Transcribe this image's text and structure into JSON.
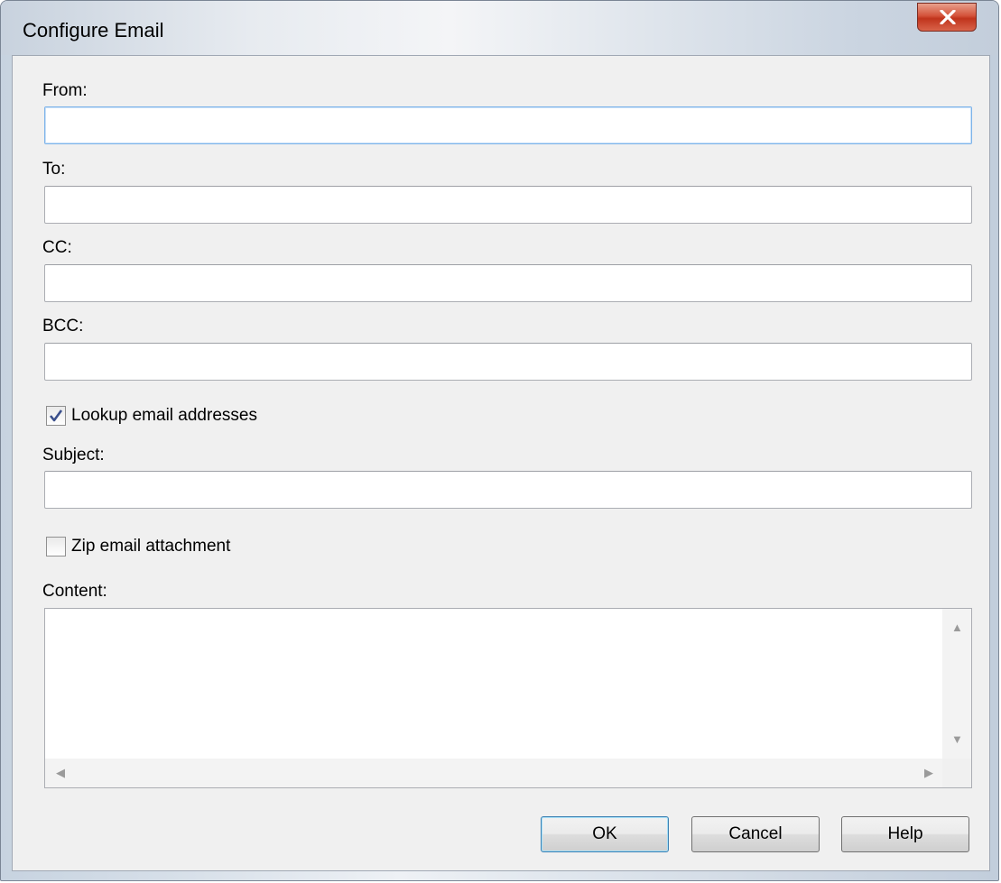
{
  "window": {
    "title": "Configure Email",
    "close_label": ""
  },
  "form": {
    "from_label": "From:",
    "from_value": "",
    "to_label": "To:",
    "to_value": "",
    "cc_label": "CC:",
    "cc_value": "",
    "bcc_label": "BCC:",
    "bcc_value": "",
    "lookup_label": "Lookup email addresses",
    "lookup_checked": true,
    "subject_label": "Subject:",
    "subject_value": "",
    "zip_label": "Zip email attachment",
    "zip_checked": false,
    "content_label": "Content:",
    "content_value": ""
  },
  "buttons": {
    "ok": "OK",
    "cancel": "Cancel",
    "help": "Help"
  },
  "icons": {
    "close": "close-x-icon",
    "checkmark": "checkmark-icon",
    "scroll_up": "scroll-up-arrow-icon",
    "scroll_down": "scroll-down-arrow-icon",
    "scroll_left": "scroll-left-arrow-icon",
    "scroll_right": "scroll-right-arrow-icon"
  },
  "colors": {
    "client_bg": "#f0f0f0",
    "close_button": "#c0341c",
    "focus_border": "#7eb4ea",
    "default_button_border": "#3c7fb1"
  }
}
